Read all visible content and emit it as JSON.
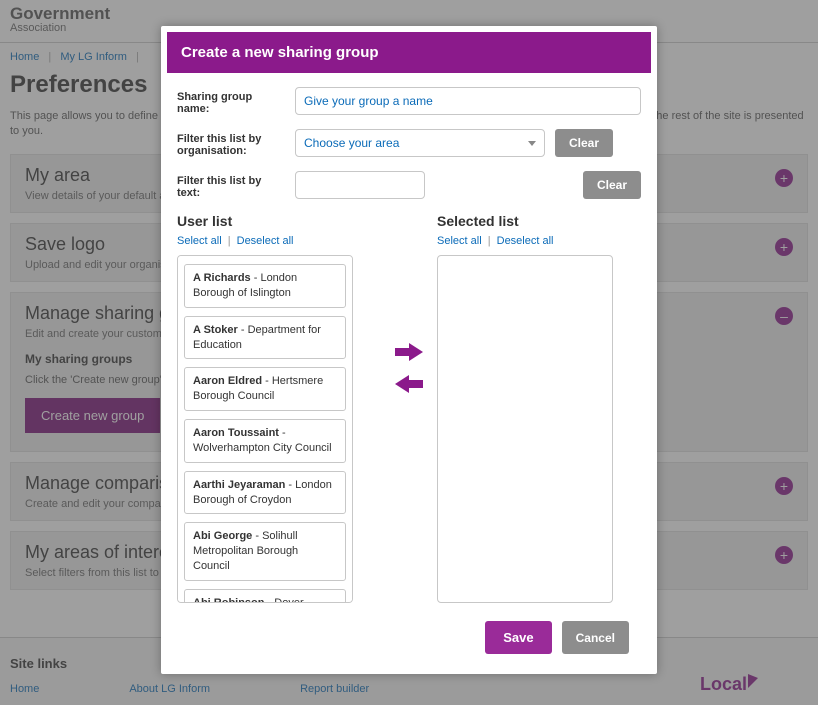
{
  "brand": {
    "line1": "Government",
    "line2": "Association"
  },
  "crumbs": {
    "home": "Home",
    "mylg": "My LG Inform"
  },
  "page": {
    "title": "Preferences",
    "intro": "This page allows you to define your default settings for the site – area, comparison group, etc. Your choices here will determine how the rest of the site is presented to you."
  },
  "panels": {
    "myarea": {
      "title": "My area",
      "desc": "View details of your default area below"
    },
    "savelogo": {
      "title": "Save logo",
      "desc": "Upload and edit your organisation's logo"
    },
    "managesharing": {
      "title": "Manage sharing groups",
      "desc": "Edit and create your custom sharing groups",
      "sub_title": "My sharing groups",
      "sub_desc": "Click the 'Create new group' button below to create a new group",
      "btn": "Create new group"
    },
    "managecomp": {
      "title": "Manage comparison groups",
      "desc": "Create and edit your comparison groups"
    },
    "myareasint": {
      "title": "My areas of interest",
      "desc": "Select filters from this list to tailor the content you see on this site"
    }
  },
  "footer": {
    "title": "Site links",
    "links": {
      "home": "Home",
      "about": "About LG Inform",
      "report": "Report builder"
    },
    "logo": "Local"
  },
  "modal": {
    "title": "Create a new sharing group",
    "labels": {
      "name": "Sharing group name:",
      "filter_org": "Filter this list by organisation:",
      "filter_text": "Filter this list by text:"
    },
    "placeholders": {
      "name": "Give your group a name",
      "area": "Choose your area"
    },
    "buttons": {
      "clear": "Clear",
      "save": "Save",
      "cancel": "Cancel"
    },
    "lists": {
      "user_title": "User list",
      "selected_title": "Selected list",
      "select_all": "Select all",
      "deselect_all": "Deselect all"
    },
    "users": [
      {
        "name": "A Richards",
        "org": "London Borough of Islington"
      },
      {
        "name": "A Stoker",
        "org": "Department for Education"
      },
      {
        "name": "Aaron Eldred",
        "org": "Hertsmere Borough Council"
      },
      {
        "name": "Aaron Toussaint",
        "org": "Wolverhampton City Council"
      },
      {
        "name": "Aarthi Jeyaraman",
        "org": "London Borough of Croydon"
      },
      {
        "name": "Abi George",
        "org": "Solihull Metropolitan Borough Council"
      },
      {
        "name": "Abi Robinson",
        "org": "Dover"
      }
    ]
  }
}
